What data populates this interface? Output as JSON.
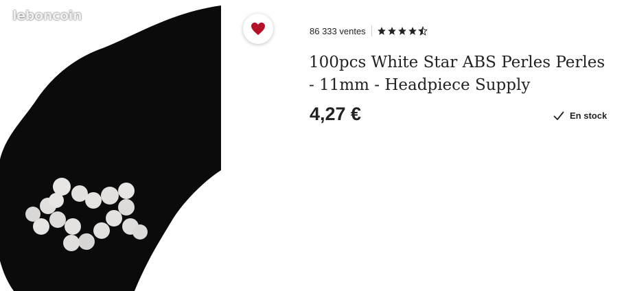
{
  "listing": {
    "watermark": "leboncoin",
    "sales_count": "86 333 ventes",
    "rating_stars": 4.5,
    "title": "100pcs White Star ABS Perles Perles - 11mm - Headpiece Supply",
    "price": "4,27 €",
    "stock_status": "En stock",
    "favorite_icon": "heart-icon",
    "favorite_color": "#b5122a"
  }
}
